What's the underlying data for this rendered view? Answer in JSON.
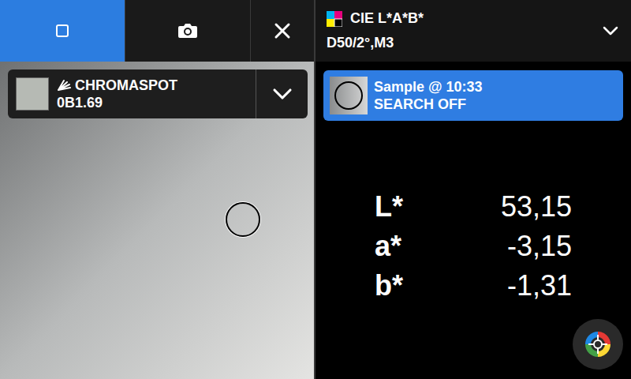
{
  "toolbar": {
    "buttons": [
      {
        "name": "preview",
        "selected": true
      },
      {
        "name": "camera",
        "selected": false
      },
      {
        "name": "close",
        "selected": false
      }
    ]
  },
  "match": {
    "brand": "CHROMASPOT",
    "code": "0B1.69"
  },
  "header": {
    "title": "CIE L*A*B*",
    "subtitle": "D50/2°,M3"
  },
  "sample": {
    "title": "Sample @ 10:33",
    "search": "SEARCH OFF"
  },
  "values": [
    {
      "label": "L*",
      "value": "53,15"
    },
    {
      "label": "a*",
      "value": "-3,15"
    },
    {
      "label": "b*",
      "value": "-1,31"
    }
  ]
}
